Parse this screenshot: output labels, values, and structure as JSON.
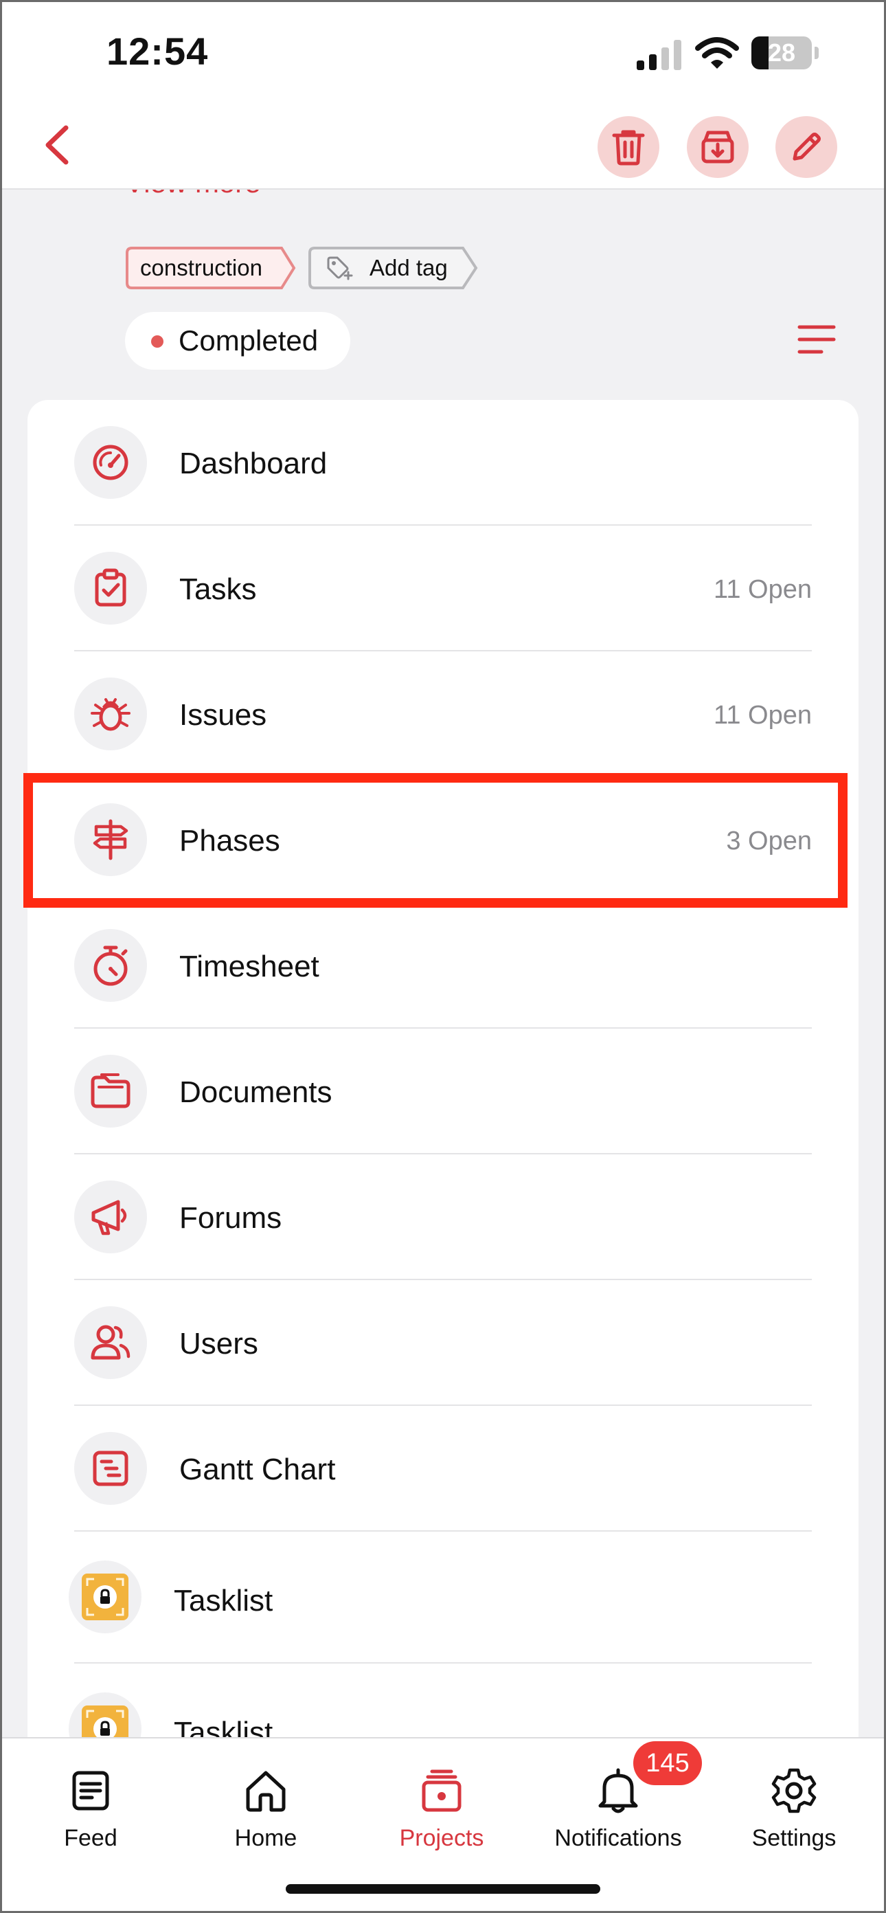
{
  "status_bar": {
    "time": "12:54",
    "battery_percent": "28",
    "battery_level": 0.28
  },
  "header": {
    "back_label": "back",
    "actions": [
      "delete",
      "archive",
      "edit"
    ]
  },
  "project": {
    "view_more": "View more",
    "tags": [
      {
        "label": "construction"
      },
      {
        "label": "Add tag"
      }
    ],
    "status": "Completed"
  },
  "menu": [
    {
      "label": "Dashboard",
      "count": "",
      "icon": "dashboard-gauge-icon"
    },
    {
      "label": "Tasks",
      "count": "11 Open",
      "icon": "clipboard-check-icon"
    },
    {
      "label": "Issues",
      "count": "11 Open",
      "icon": "bug-icon"
    },
    {
      "label": "Phases",
      "count": "3 Open",
      "icon": "signpost-icon"
    },
    {
      "label": "Timesheet",
      "count": "",
      "icon": "stopwatch-icon"
    },
    {
      "label": "Documents",
      "count": "",
      "icon": "folder-icon"
    },
    {
      "label": "Forums",
      "count": "",
      "icon": "megaphone-icon"
    },
    {
      "label": "Users",
      "count": "",
      "icon": "users-icon"
    },
    {
      "label": "Gantt Chart",
      "count": "",
      "icon": "gantt-icon"
    },
    {
      "label": "Tasklist",
      "count": "",
      "icon": "locked-tasklist-icon"
    },
    {
      "label": "Tasklist",
      "count": "",
      "icon": "locked-tasklist-icon"
    }
  ],
  "tabs": [
    {
      "label": "Feed",
      "icon": "feed-icon",
      "active": false
    },
    {
      "label": "Home",
      "icon": "home-icon",
      "active": false
    },
    {
      "label": "Projects",
      "icon": "projects-icon",
      "active": true
    },
    {
      "label": "Notifications",
      "icon": "bell-icon",
      "active": false
    },
    {
      "label": "Settings",
      "icon": "gear-icon",
      "active": false
    }
  ],
  "notifications_badge": "145",
  "colors": {
    "accent": "#d7373f",
    "accent_soft": "#f6d3d2",
    "highlight": "#ff2a12",
    "tasklist_icon": "#f2b33d",
    "badge": "#ef3b38"
  }
}
